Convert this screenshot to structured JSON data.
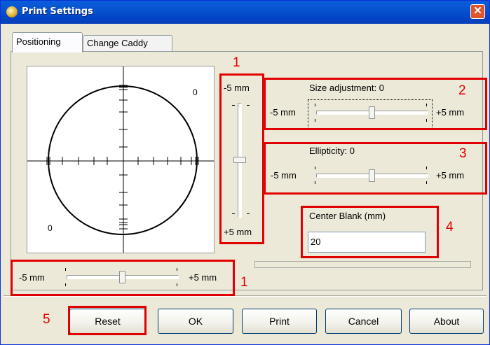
{
  "window": {
    "title": "Print Settings",
    "close_label": "✕",
    "title_icon": "app-disc-icon",
    "close_icon": "close-icon"
  },
  "tabs": [
    {
      "label": "Positioning",
      "active": true
    },
    {
      "label": "Change Caddy",
      "active": false
    }
  ],
  "preview": {
    "top_right_value": "0",
    "bottom_left_value": "0"
  },
  "vertical_slider": {
    "min_label": "-5 mm",
    "max_label": "+5 mm",
    "value": 0
  },
  "horizontal_slider": {
    "min_label": "-5 mm",
    "max_label": "+5 mm",
    "value": 0
  },
  "size_adjustment": {
    "label": "Size adjustment: 0",
    "min_label": "-5 mm",
    "max_label": "+5 mm",
    "value": 0
  },
  "ellipticity": {
    "label": "Ellipticity: 0",
    "min_label": "-5 mm",
    "max_label": "+5 mm",
    "value": 0
  },
  "center_blank": {
    "label": "Center Blank (mm)",
    "value": "20"
  },
  "progress": {
    "value": 0
  },
  "buttons": {
    "reset": "Reset",
    "ok": "OK",
    "print": "Print",
    "cancel": "Cancel",
    "about": "About"
  },
  "annotations": {
    "vertical_slider": "1",
    "size": "2",
    "ellipticity": "3",
    "center_blank": "4",
    "reset": "5",
    "horizontal_slider": "1"
  },
  "colors": {
    "titlebar": "#0054e3",
    "highlight": "#e00000",
    "face": "#ece9d8"
  }
}
